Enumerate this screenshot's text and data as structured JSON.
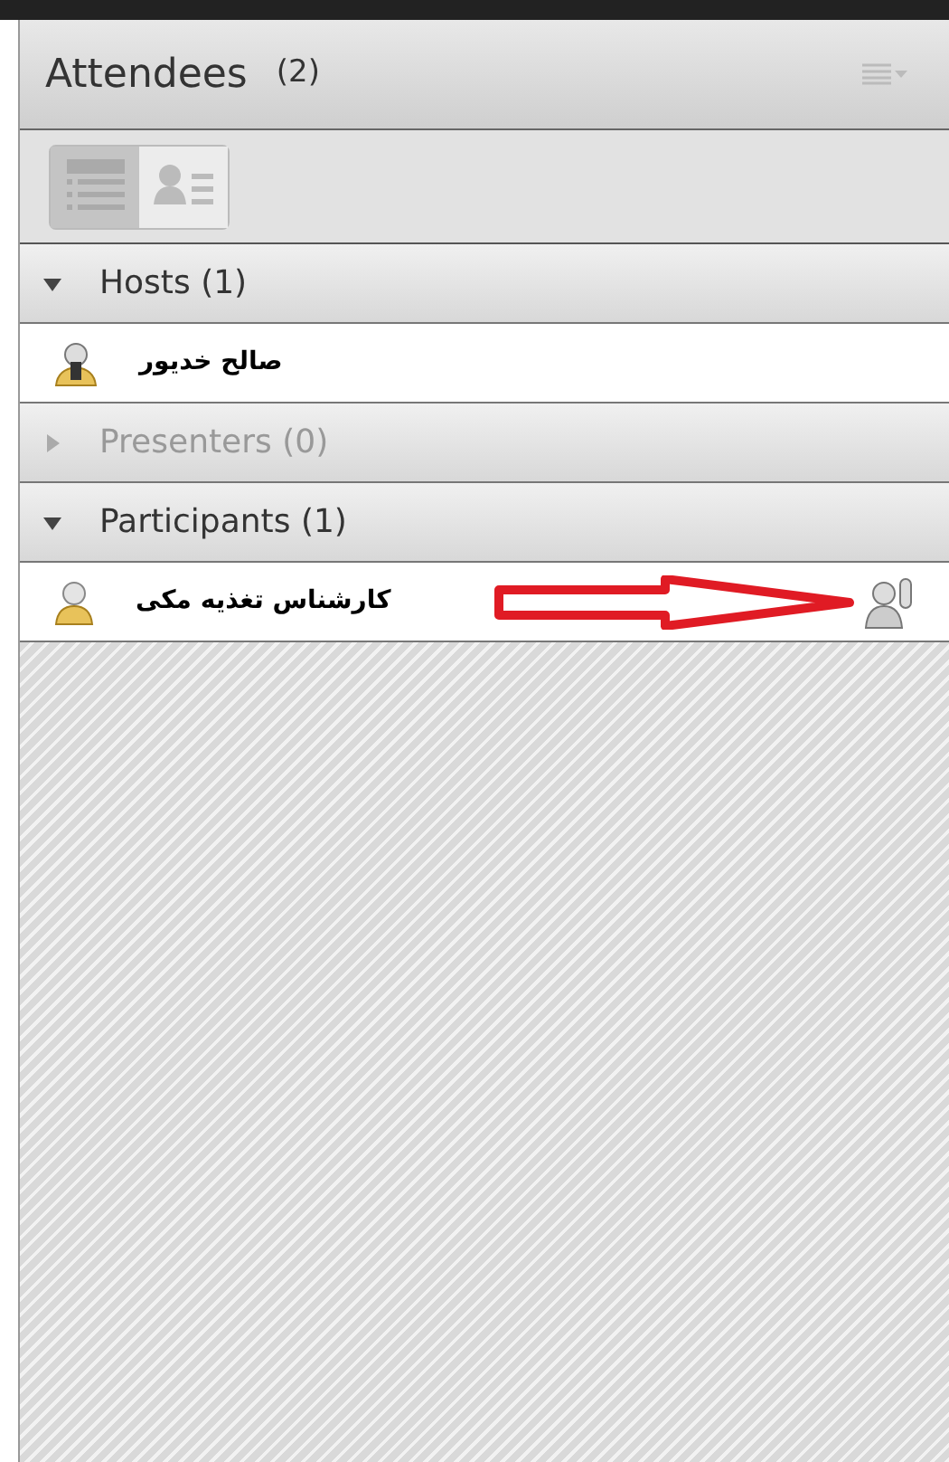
{
  "panel": {
    "title": "Attendees",
    "count": "(2)"
  },
  "view_toggles": [
    {
      "kind": "list",
      "selected": true
    },
    {
      "kind": "cards",
      "selected": false
    }
  ],
  "sections": [
    {
      "label": "Hosts (1)",
      "expanded": true,
      "disabled": false,
      "attendees": [
        {
          "name": "صالح خدیور",
          "kind": "host",
          "hand_raised": false
        }
      ]
    },
    {
      "label": "Presenters (0)",
      "expanded": false,
      "disabled": true
    },
    {
      "label": "Participants (1)",
      "expanded": true,
      "disabled": false,
      "attendees": [
        {
          "name": "کارشناس تغذیه مکی",
          "kind": "participant",
          "hand_raised": true
        }
      ]
    }
  ]
}
